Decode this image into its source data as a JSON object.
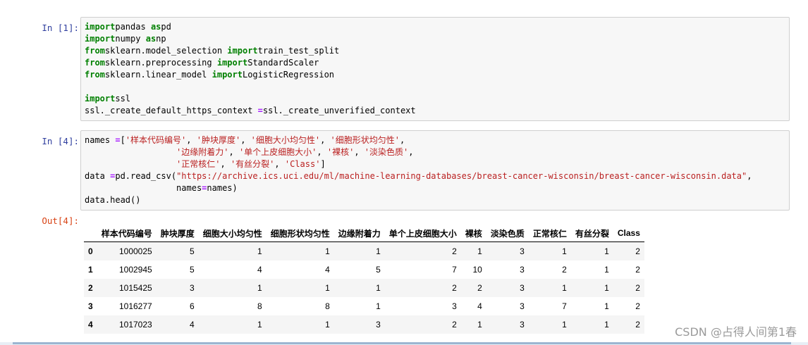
{
  "cells": [
    {
      "prompt": "In  [1]:",
      "lines": [
        [
          [
            "kw",
            "import"
          ],
          [
            "",
            "pandas "
          ],
          [
            "kw",
            "as"
          ],
          [
            "",
            "pd"
          ]
        ],
        [
          [
            "kw",
            "import"
          ],
          [
            "",
            "numpy "
          ],
          [
            "kw",
            "as"
          ],
          [
            "",
            "np"
          ]
        ],
        [
          [
            "kw",
            "from"
          ],
          [
            "",
            "sklearn.model_selection "
          ],
          [
            "kw",
            "import"
          ],
          [
            "",
            "train_test_split"
          ]
        ],
        [
          [
            "kw",
            "from"
          ],
          [
            "",
            "sklearn.preprocessing "
          ],
          [
            "kw",
            "import"
          ],
          [
            "",
            "StandardScaler"
          ]
        ],
        [
          [
            "kw",
            "from"
          ],
          [
            "",
            "sklearn.linear_model "
          ],
          [
            "kw",
            "import"
          ],
          [
            "",
            "LogisticRegression"
          ]
        ],
        [],
        [
          [
            "kw",
            "import"
          ],
          [
            "",
            "ssl"
          ]
        ],
        [
          [
            "",
            "ssl._create_default_https_context "
          ],
          [
            "op",
            "="
          ],
          [
            "",
            "ssl._create_unverified_context"
          ]
        ]
      ]
    },
    {
      "prompt": "In  [4]:",
      "lines": [
        [
          [
            "",
            "names "
          ],
          [
            "op",
            "="
          ],
          [
            "",
            "["
          ],
          [
            "str",
            "'样本代码编号'"
          ],
          [
            "",
            ", "
          ],
          [
            "str",
            "'肿块厚度'"
          ],
          [
            "",
            ", "
          ],
          [
            "str",
            "'细胞大小均匀性'"
          ],
          [
            "",
            ", "
          ],
          [
            "str",
            "'细胞形状均匀性'"
          ],
          [
            "",
            ","
          ]
        ],
        [
          [
            "",
            "                  "
          ],
          [
            "str",
            "'边缘附着力'"
          ],
          [
            "",
            ", "
          ],
          [
            "str",
            "'单个上皮细胞大小'"
          ],
          [
            "",
            ", "
          ],
          [
            "str",
            "'裸核'"
          ],
          [
            "",
            ", "
          ],
          [
            "str",
            "'淡染色质'"
          ],
          [
            "",
            ","
          ]
        ],
        [
          [
            "",
            "                  "
          ],
          [
            "str",
            "'正常核仁'"
          ],
          [
            "",
            ", "
          ],
          [
            "str",
            "'有丝分裂'"
          ],
          [
            "",
            ", "
          ],
          [
            "str",
            "'Class'"
          ],
          [
            "",
            "]"
          ]
        ],
        [
          [
            "",
            "data "
          ],
          [
            "op",
            "="
          ],
          [
            "",
            "pd.read_csv("
          ],
          [
            "str",
            "\"https://archive.ics.uci.edu/ml/machine-learning-databases/breast-cancer-wisconsin/breast-cancer-wisconsin.data\""
          ],
          [
            "",
            ","
          ]
        ],
        [
          [
            "",
            "                  names"
          ],
          [
            "op",
            "="
          ],
          [
            "",
            "names)"
          ]
        ],
        [
          [
            "",
            "data.head()"
          ]
        ]
      ]
    }
  ],
  "output": {
    "prompt": "Out[4]:",
    "columns": [
      "",
      "样本代码编号",
      "肿块厚度",
      "细胞大小均匀性",
      "细胞形状均匀性",
      "边缘附着力",
      "单个上皮细胞大小",
      "裸核",
      "淡染色质",
      "正常核仁",
      "有丝分裂",
      "Class"
    ],
    "rows": [
      [
        "0",
        "1000025",
        "5",
        "1",
        "1",
        "1",
        "2",
        "1",
        "3",
        "1",
        "1",
        "2"
      ],
      [
        "1",
        "1002945",
        "5",
        "4",
        "4",
        "5",
        "7",
        "10",
        "3",
        "2",
        "1",
        "2"
      ],
      [
        "2",
        "1015425",
        "3",
        "1",
        "1",
        "1",
        "2",
        "2",
        "3",
        "1",
        "1",
        "2"
      ],
      [
        "3",
        "1016277",
        "6",
        "8",
        "8",
        "1",
        "3",
        "4",
        "3",
        "7",
        "1",
        "2"
      ],
      [
        "4",
        "1017023",
        "4",
        "1",
        "1",
        "3",
        "2",
        "1",
        "3",
        "1",
        "1",
        "2"
      ]
    ]
  },
  "watermark": "CSDN @占得人间第1春",
  "colors": {
    "keyword": "#008000",
    "string": "#BA2121",
    "operator": "#AA22FF",
    "in_prompt": "#303F9F",
    "out_prompt": "#D84315"
  }
}
